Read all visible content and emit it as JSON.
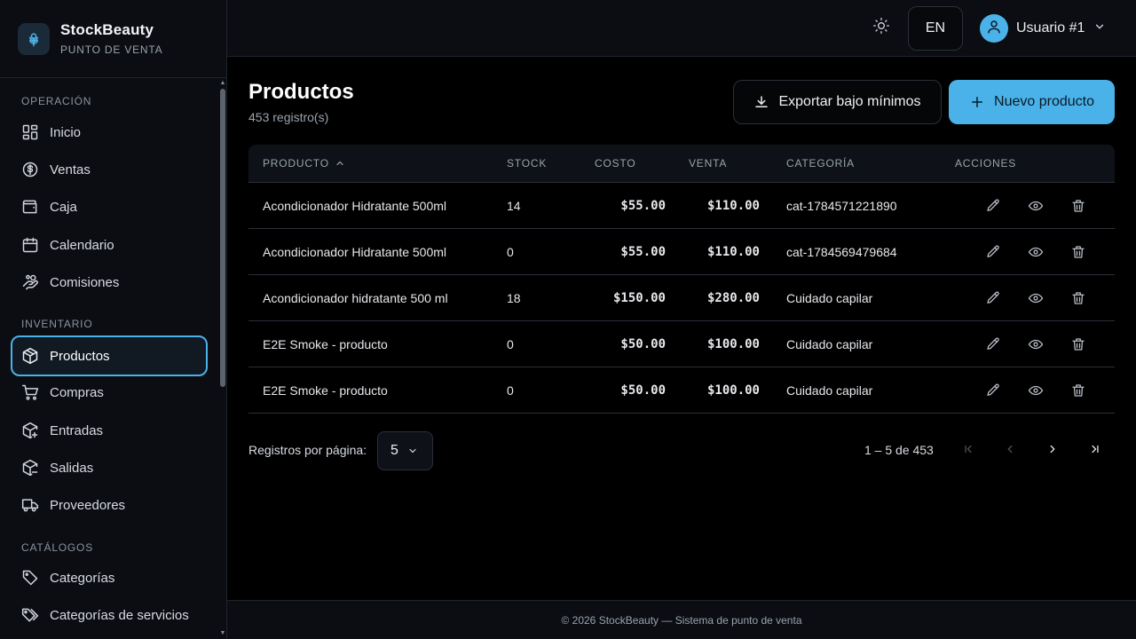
{
  "brand": {
    "name": "StockBeauty",
    "subtitle": "PUNTO DE VENTA",
    "logo_icon": "flower-icon"
  },
  "sidebar": {
    "sections": [
      {
        "title": "OPERACIÓN",
        "items": [
          {
            "label": "Inicio",
            "icon": "dashboard-icon"
          },
          {
            "label": "Ventas",
            "icon": "dollar-circle-icon"
          },
          {
            "label": "Caja",
            "icon": "wallet-icon"
          },
          {
            "label": "Calendario",
            "icon": "calendar-icon"
          },
          {
            "label": "Comisiones",
            "icon": "hand-coins-icon"
          }
        ]
      },
      {
        "title": "INVENTARIO",
        "items": [
          {
            "label": "Productos",
            "icon": "package-icon",
            "active": true
          },
          {
            "label": "Compras",
            "icon": "cart-icon"
          },
          {
            "label": "Entradas",
            "icon": "package-plus-icon"
          },
          {
            "label": "Salidas",
            "icon": "package-minus-icon"
          },
          {
            "label": "Proveedores",
            "icon": "truck-icon"
          }
        ]
      },
      {
        "title": "CATÁLOGOS",
        "items": [
          {
            "label": "Categorías",
            "icon": "tag-icon"
          },
          {
            "label": "Categorías de servicios",
            "icon": "tags-icon"
          }
        ]
      }
    ]
  },
  "header": {
    "language": "EN",
    "user_name": "Usuario #1",
    "theme_icon": "sun-icon"
  },
  "page": {
    "title": "Productos",
    "count": "453 registro(s)",
    "export_label": "Exportar bajo mínimos",
    "new_label": "Nuevo producto"
  },
  "table": {
    "columns": [
      "PRODUCTO",
      "STOCK",
      "COSTO",
      "VENTA",
      "CATEGORÍA",
      "ACCIONES"
    ],
    "rows": [
      {
        "product": "Acondicionador Hidratante 500ml",
        "stock": "14",
        "cost": "$55.00",
        "sale": "$110.00",
        "category": "cat-1784571221890"
      },
      {
        "product": "Acondicionador Hidratante 500ml",
        "stock": "0",
        "cost": "$55.00",
        "sale": "$110.00",
        "category": "cat-1784569479684"
      },
      {
        "product": "Acondicionador hidratante 500 ml",
        "stock": "18",
        "cost": "$150.00",
        "sale": "$280.00",
        "category": "Cuidado capilar"
      },
      {
        "product": "E2E Smoke - producto",
        "stock": "0",
        "cost": "$50.00",
        "sale": "$100.00",
        "category": "Cuidado capilar"
      },
      {
        "product": "E2E Smoke - producto",
        "stock": "0",
        "cost": "$50.00",
        "sale": "$100.00",
        "category": "Cuidado capilar"
      }
    ]
  },
  "pagination": {
    "rows_per_page_label": "Registros por página:",
    "rows_per_page": "5",
    "range": "1 – 5 de 453"
  },
  "footer": {
    "text": "© 2026 StockBeauty — Sistema de punto de venta"
  },
  "colors": {
    "accent": "#4ab2e8",
    "background": "#000000",
    "sidebar": "#0b0d12"
  }
}
